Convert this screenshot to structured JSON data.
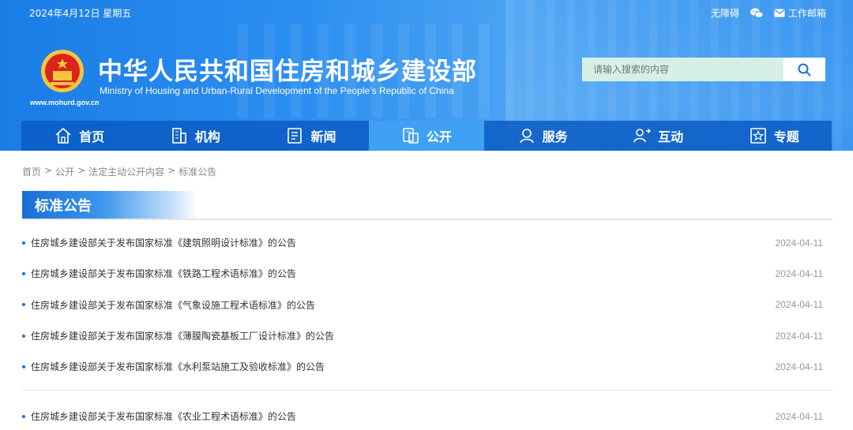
{
  "topbar": {
    "date": "2024年4月12日 星期五",
    "accessibility": "无障碍",
    "mailbox": "工作邮箱"
  },
  "header": {
    "url": "www.mohurd.gov.cn",
    "title": "中华人民共和国住房和城乡建设部",
    "subtitle": "Ministry of Housing and Urban-Rural Development of the People’s Republic of China",
    "search_placeholder": "请输入搜索的内容"
  },
  "nav": [
    {
      "label": "首页",
      "icon": "home-icon"
    },
    {
      "label": "机构",
      "icon": "building-icon"
    },
    {
      "label": "新闻",
      "icon": "news-icon"
    },
    {
      "label": "公开",
      "icon": "document-icon",
      "active": true
    },
    {
      "label": "服务",
      "icon": "service-icon"
    },
    {
      "label": "互动",
      "icon": "interaction-icon"
    },
    {
      "label": "专题",
      "icon": "star-icon"
    }
  ],
  "breadcrumb": [
    "首页",
    "公开",
    "法定主动公开内容",
    "标准公告"
  ],
  "section": {
    "title": "标准公告"
  },
  "announcements": [
    {
      "title": "住房城乡建设部关于发布国家标准《建筑照明设计标准》的公告",
      "date": "2024-04-11"
    },
    {
      "title": "住房城乡建设部关于发布国家标准《铁路工程术语标准》的公告",
      "date": "2024-04-11"
    },
    {
      "title": "住房城乡建设部关于发布国家标准《气象设施工程术语标准》的公告",
      "date": "2024-04-11"
    },
    {
      "title": "住房城乡建设部关于发布国家标准《薄膜陶瓷基板工厂设计标准》的公告",
      "date": "2024-04-11"
    },
    {
      "title": "住房城乡建设部关于发布国家标准《水利泵站施工及验收标准》的公告",
      "date": "2024-04-11"
    }
  ],
  "announcements_more": [
    {
      "title": "住房城乡建设部关于发布国家标准《农业工程术语标准》的公告",
      "date": "2024-04-11"
    }
  ],
  "colors": {
    "header_blue": "#1a7de6",
    "nav_active": "#3fa0f4",
    "accent": "#1a6fd6"
  }
}
